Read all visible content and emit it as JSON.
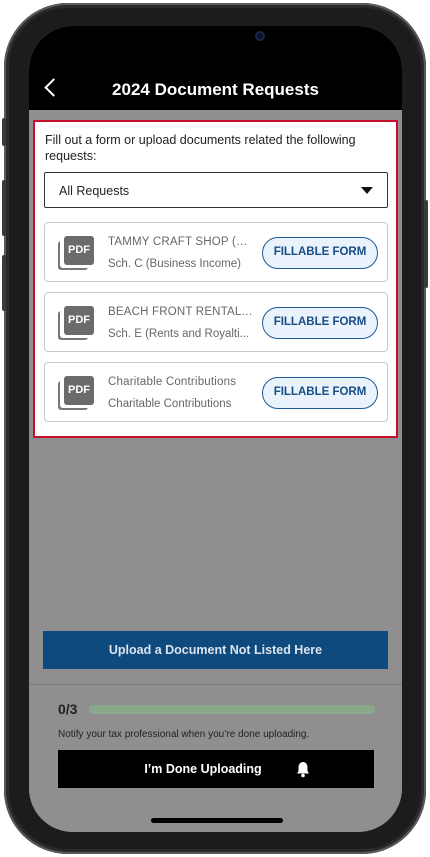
{
  "header": {
    "title": "2024 Document Requests"
  },
  "intro_text": "Fill out a form or upload documents related the following requests:",
  "filter": {
    "selected": "All Requests"
  },
  "requests": [
    {
      "icon": "pdf-icon",
      "line1": "TAMMY CRAFT SHOP (Ta...",
      "line2": "Sch. C (Business Income)",
      "button": "FILLABLE FORM"
    },
    {
      "icon": "pdf-icon",
      "line1": "BEACH FRONT RENTAL (J...",
      "line2": "Sch. E (Rents and Royalti...",
      "button": "FILLABLE FORM"
    },
    {
      "icon": "pdf-icon",
      "line1": "Charitable Contributions",
      "line2": "Charitable Contributions",
      "button": "FILLABLE FORM"
    }
  ],
  "upload_button": "Upload a Document Not Listed Here",
  "progress": {
    "label": "0/3",
    "fraction": 0
  },
  "notify_text": "Notify your tax professional when you’re done uploading.",
  "done_button": "I’m Done Uploading",
  "pdf_icon_text": "PDF",
  "colors": {
    "header_bg": "#000000",
    "highlight_border": "#c8102e",
    "primary_button": "#0e4a7d",
    "fillable_button_text": "#174e87"
  }
}
